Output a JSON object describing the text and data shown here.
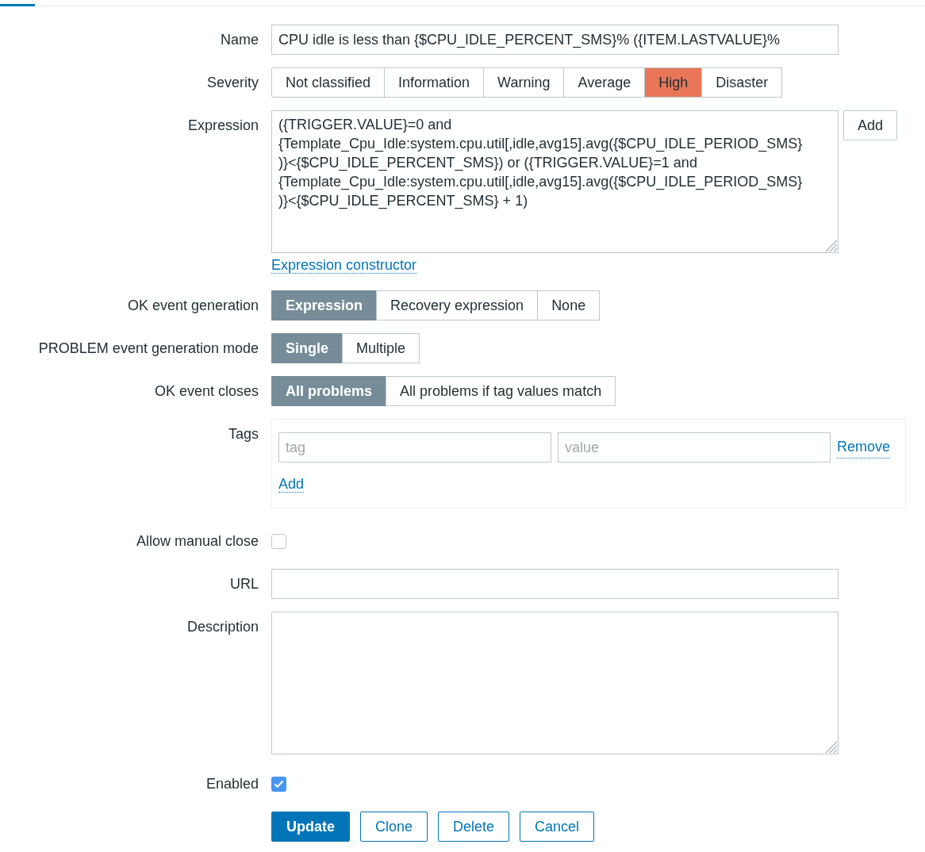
{
  "top_tabs": [
    {
      "selected": true
    }
  ],
  "name": {
    "label": "Name",
    "value": "CPU idle is less than {$CPU_IDLE_PERCENT_SMS}% ({ITEM.LASTVALUE}%"
  },
  "severity": {
    "label": "Severity",
    "options": [
      {
        "label": "Not classified",
        "selected": false
      },
      {
        "label": "Information",
        "selected": false
      },
      {
        "label": "Warning",
        "selected": false
      },
      {
        "label": "Average",
        "selected": false
      },
      {
        "label": "High",
        "selected": true,
        "color": "#e97659"
      },
      {
        "label": "Disaster",
        "selected": false
      }
    ]
  },
  "expression": {
    "label": "Expression",
    "lines": [
      "({TRIGGER.VALUE}=0 and",
      "{Template_Cpu_Idle:system.cpu.util[,idle,avg15].avg({$CPU_IDLE_PERIOD_SMS}",
      ")}<{$CPU_IDLE_PERCENT_SMS}) or ({TRIGGER.VALUE}=1 and",
      "{Template_Cpu_Idle:system.cpu.util[,idle,avg15].avg({$CPU_IDLE_PERIOD_SMS}",
      ")}<{$CPU_IDLE_PERCENT_SMS} + 1)"
    ],
    "add_button": "Add",
    "constructor_link": "Expression constructor"
  },
  "radio_groups": [
    {
      "label": "OK event generation",
      "options": [
        {
          "label": "Expression",
          "selected": true
        },
        {
          "label": "Recovery expression",
          "selected": false
        },
        {
          "label": "None",
          "selected": false
        }
      ]
    },
    {
      "label": "PROBLEM event generation mode",
      "options": [
        {
          "label": "Single",
          "selected": true
        },
        {
          "label": "Multiple",
          "selected": false
        }
      ]
    },
    {
      "label": "OK event closes",
      "options": [
        {
          "label": "All problems",
          "selected": true
        },
        {
          "label": "All problems if tag values match",
          "selected": false
        }
      ]
    }
  ],
  "tags": {
    "label": "Tags",
    "rows": [
      {
        "tag_placeholder": "tag",
        "value_placeholder": "value",
        "remove": "Remove"
      }
    ],
    "add": "Add"
  },
  "allow_manual_close": {
    "label": "Allow manual close",
    "checked": false
  },
  "url": {
    "label": "URL"
  },
  "description": {
    "label": "Description"
  },
  "enabled": {
    "label": "Enabled",
    "checked": true
  },
  "buttons": [
    {
      "label": "Update",
      "kind": "primary"
    },
    {
      "label": "Clone",
      "kind": "secondary"
    },
    {
      "label": "Delete",
      "kind": "secondary"
    },
    {
      "label": "Cancel",
      "kind": "secondary"
    }
  ]
}
